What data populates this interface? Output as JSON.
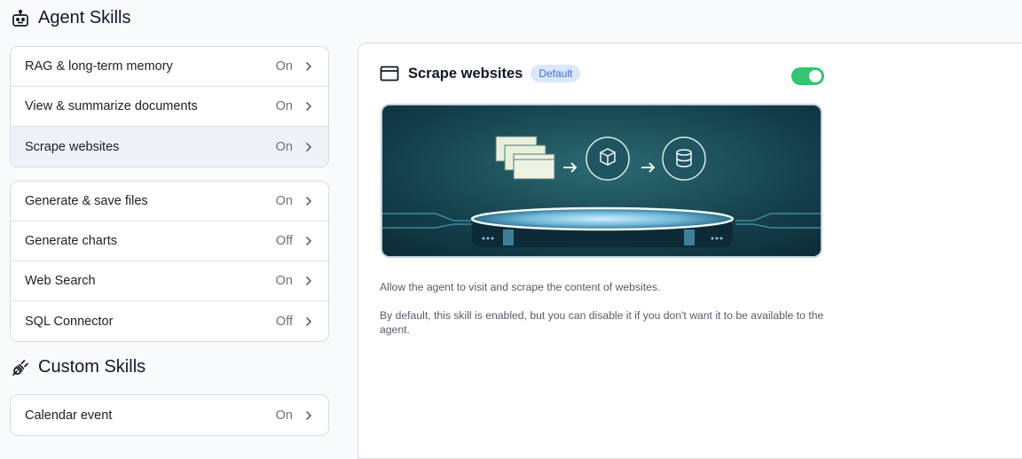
{
  "agent_skills": {
    "title": "Agent Skills",
    "icon": "robot-icon",
    "group1": [
      {
        "label": "RAG & long-term memory",
        "status": "On"
      },
      {
        "label": "View & summarize documents",
        "status": "On"
      },
      {
        "label": "Scrape websites",
        "status": "On",
        "selected": true
      }
    ],
    "group2": [
      {
        "label": "Generate & save files",
        "status": "On"
      },
      {
        "label": "Generate charts",
        "status": "Off"
      },
      {
        "label": "Web Search",
        "status": "On"
      },
      {
        "label": "SQL Connector",
        "status": "Off"
      }
    ]
  },
  "custom_skills": {
    "title": "Custom Skills",
    "icon": "plug-icon",
    "items": [
      {
        "label": "Calendar event",
        "status": "On"
      }
    ]
  },
  "detail": {
    "icon": "browser-window-icon",
    "title": "Scrape websites",
    "badge": "Default",
    "enabled": true,
    "toggle_color": "#34c472",
    "description_1": "Allow the agent to visit and scrape the content of websites.",
    "description_2": "By default, this skill is enabled, but you can disable it if you don't want it to be available to the agent."
  }
}
